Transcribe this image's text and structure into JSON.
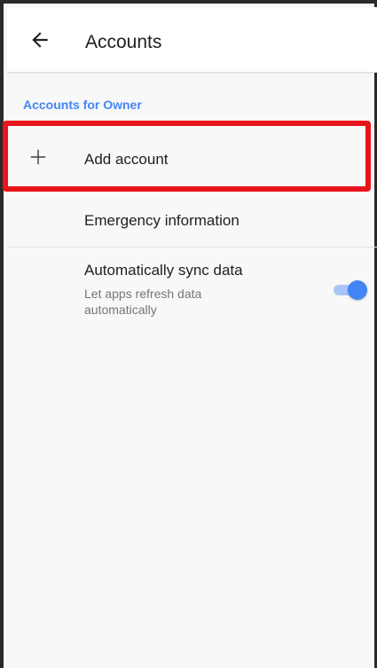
{
  "appbar": {
    "title": "Accounts",
    "back_icon": "arrow-back-icon"
  },
  "section": {
    "header": "Accounts for Owner"
  },
  "items": [
    {
      "label": "Add account",
      "icon": "plus-icon"
    },
    {
      "label": "Emergency information"
    },
    {
      "label": "Automatically sync data",
      "sublabel": "Let apps refresh data automatically",
      "toggle_on": true
    }
  ],
  "colors": {
    "accent": "#4285f4",
    "highlight": "#e8141b"
  }
}
